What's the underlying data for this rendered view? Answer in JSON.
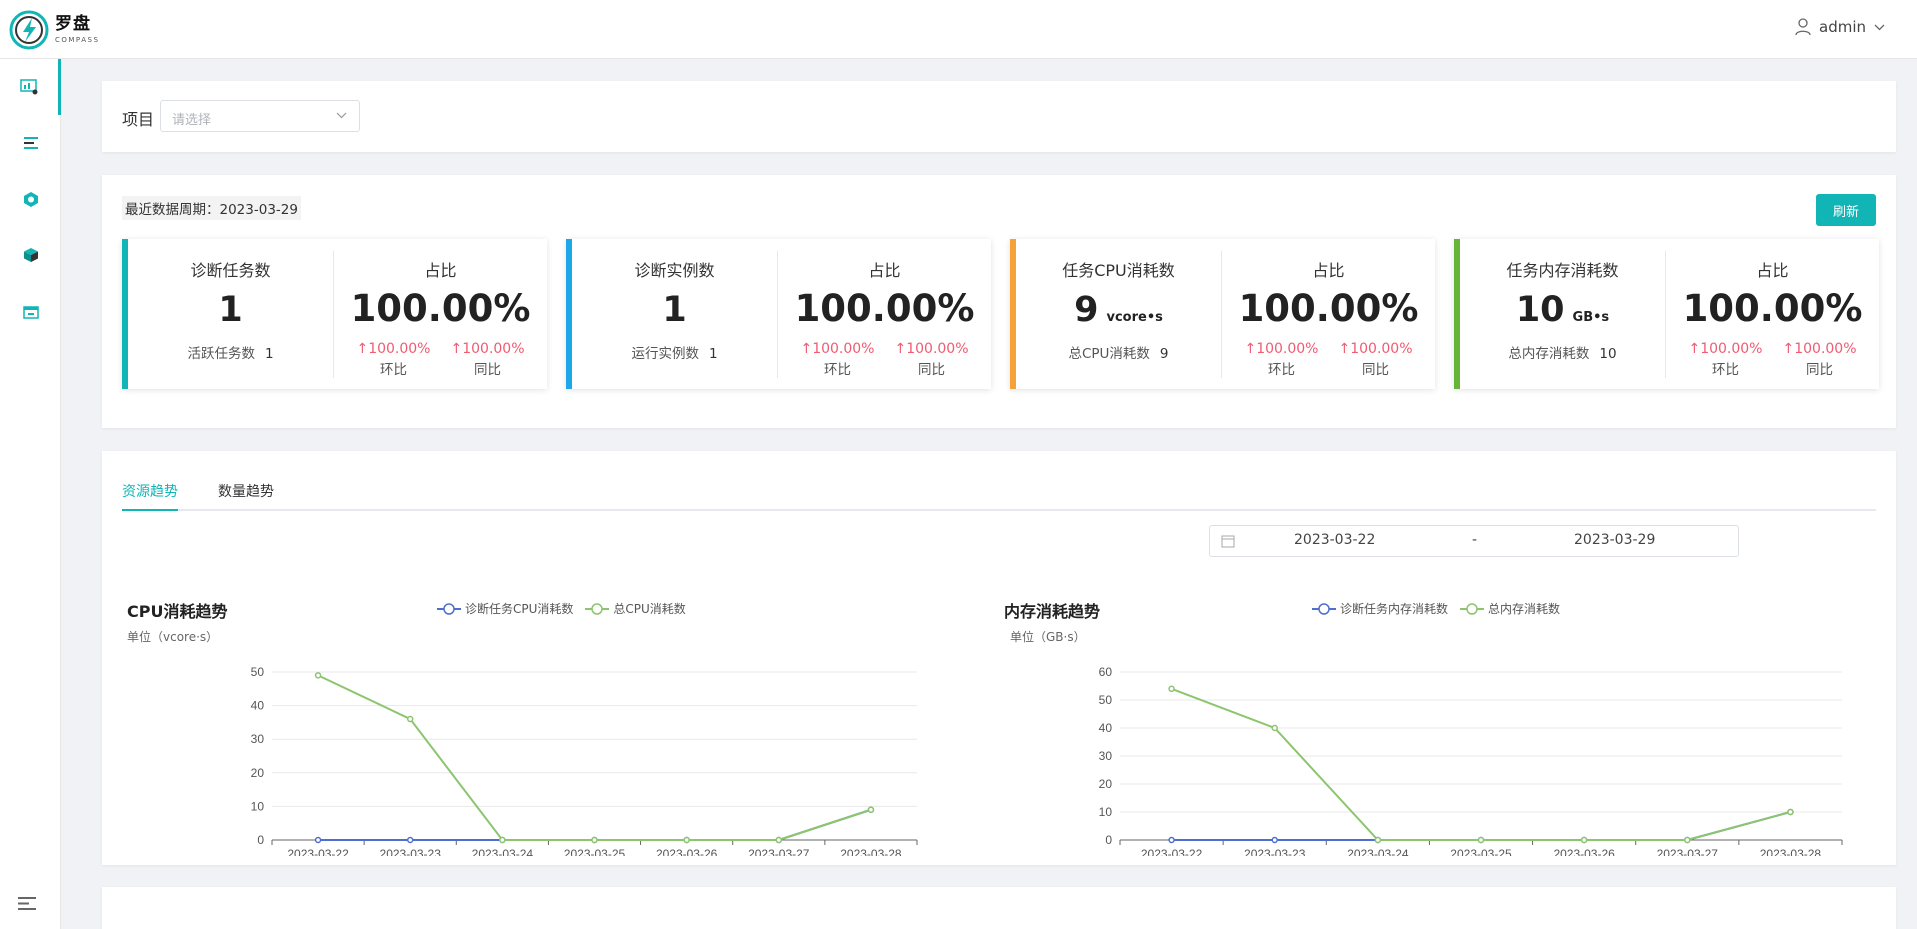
{
  "app": {
    "logo_cn": "罗盘",
    "logo_en": "COMPASS",
    "brand_color": "#11b5b5"
  },
  "user": {
    "name": "admin"
  },
  "sidebar": {
    "items": [
      {
        "icon": "dashboard-icon",
        "active": true
      },
      {
        "icon": "list-icon",
        "active": false
      },
      {
        "icon": "hexagon-icon",
        "active": false
      },
      {
        "icon": "cube-icon",
        "active": false
      },
      {
        "icon": "calendar-icon",
        "active": false
      }
    ]
  },
  "filter": {
    "label": "项目",
    "placeholder": "请选择"
  },
  "summary": {
    "period": "最近数据周期：2023-03-29",
    "refresh_label": "刷新",
    "ratio_title": "占比",
    "qoq_label": "环比",
    "yoy_label": "同比",
    "cards": [
      {
        "color": "#11b5b5",
        "title": "诊断任务数",
        "value": "1",
        "unit": "",
        "sub_label": "活跃任务数",
        "sub_value": "1",
        "pct": "100.00%",
        "qoq": "↑100.00%",
        "yoy": "↑100.00%"
      },
      {
        "color": "#1ea7ea",
        "title": "诊断实例数",
        "value": "1",
        "unit": "",
        "sub_label": "运行实例数",
        "sub_value": "1",
        "pct": "100.00%",
        "qoq": "↑100.00%",
        "yoy": "↑100.00%"
      },
      {
        "color": "#f5a23a",
        "title": "任务CPU消耗数",
        "value": "9",
        "unit": "vcore•s",
        "sub_label": "总CPU消耗数",
        "sub_value": "9",
        "pct": "100.00%",
        "qoq": "↑100.00%",
        "yoy": "↑100.00%"
      },
      {
        "color": "#66b538",
        "title": "任务内存消耗数",
        "value": "10",
        "unit": "GB•s",
        "sub_label": "总内存消耗数",
        "sub_value": "10",
        "pct": "100.00%",
        "qoq": "↑100.00%",
        "yoy": "↑100.00%"
      }
    ]
  },
  "trend": {
    "tabs": [
      {
        "label": "资源趋势",
        "active": true
      },
      {
        "label": "数量趋势",
        "active": false
      }
    ],
    "date_start": "2023-03-22",
    "date_sep": "-",
    "date_end": "2023-03-29"
  },
  "chart_data": [
    {
      "type": "line",
      "title": "CPU消耗趋势",
      "unit_label": "单位（vcore·s）",
      "categories": [
        "2023-03-22",
        "2023-03-23",
        "2023-03-24",
        "2023-03-25",
        "2023-03-26",
        "2023-03-27",
        "2023-03-28"
      ],
      "ylim": [
        0,
        50
      ],
      "yticks": [
        0,
        10,
        20,
        30,
        40,
        50
      ],
      "series": [
        {
          "name": "诊断任务CPU消耗数",
          "color": "#4f6fcf",
          "values": [
            0,
            0,
            0,
            0,
            0,
            0,
            9
          ]
        },
        {
          "name": "总CPU消耗数",
          "color": "#8cc56e",
          "values": [
            49,
            36,
            0,
            0,
            0,
            0,
            9
          ]
        }
      ],
      "legend": "top-center",
      "grid": true
    },
    {
      "type": "line",
      "title": "内存消耗趋势",
      "unit_label": "单位（GB·s）",
      "categories": [
        "2023-03-22",
        "2023-03-23",
        "2023-03-24",
        "2023-03-25",
        "2023-03-26",
        "2023-03-27",
        "2023-03-28"
      ],
      "ylim": [
        0,
        60
      ],
      "yticks": [
        0,
        10,
        20,
        30,
        40,
        50,
        60
      ],
      "series": [
        {
          "name": "诊断任务内存消耗数",
          "color": "#4f6fcf",
          "values": [
            0,
            0,
            0,
            0,
            0,
            0,
            10
          ]
        },
        {
          "name": "总内存消耗数",
          "color": "#8cc56e",
          "values": [
            54,
            40,
            0,
            0,
            0,
            0,
            10
          ]
        }
      ],
      "legend": "top-center",
      "grid": true
    }
  ]
}
